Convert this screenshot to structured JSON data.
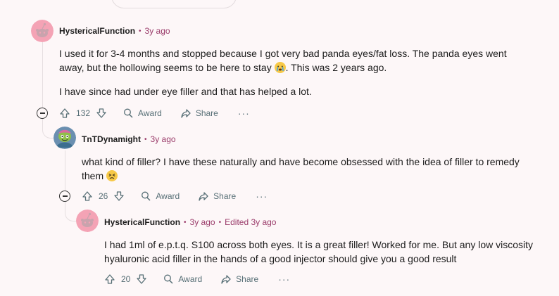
{
  "comments": [
    {
      "author": "HystericalFunction",
      "time": "3y ago",
      "edited": "",
      "paragraphs": [
        "I used it for 3-4 months and stopped because I got very bad panda eyes/fat loss. The panda eyes went away, but the hollowing seems to be here to stay ",
        ". This was 2 years ago.",
        "I have since had under eye filler and that has helped a lot."
      ],
      "emoji": "crying-face",
      "votes": "132",
      "award_label": "Award",
      "share_label": "Share",
      "more_label": "···"
    },
    {
      "author": "TnTDynamight",
      "time": "3y ago",
      "edited": "",
      "paragraphs": [
        "what kind of filler? I have these naturally and have become obsessed with the idea of filler to remedy them "
      ],
      "emoji": "persevering-face",
      "votes": "26",
      "award_label": "Award",
      "share_label": "Share",
      "more_label": "···"
    },
    {
      "author": "HystericalFunction",
      "time": "3y ago",
      "edited": "Edited 3y ago",
      "paragraphs": [
        "I had 1ml of e.p.t.q. S100 across both eyes. It is a great filler! Worked for me. But any low viscosity hyaluronic acid filler in the hands of a good injector should give you a good result"
      ],
      "votes": "20",
      "award_label": "Award",
      "share_label": "Share",
      "more_label": "···"
    }
  ],
  "colors": {
    "meta": "#9a3b6a",
    "action": "#576f76",
    "thread": "#e6dfe1",
    "avatar_pink": "#f4a3b5"
  }
}
